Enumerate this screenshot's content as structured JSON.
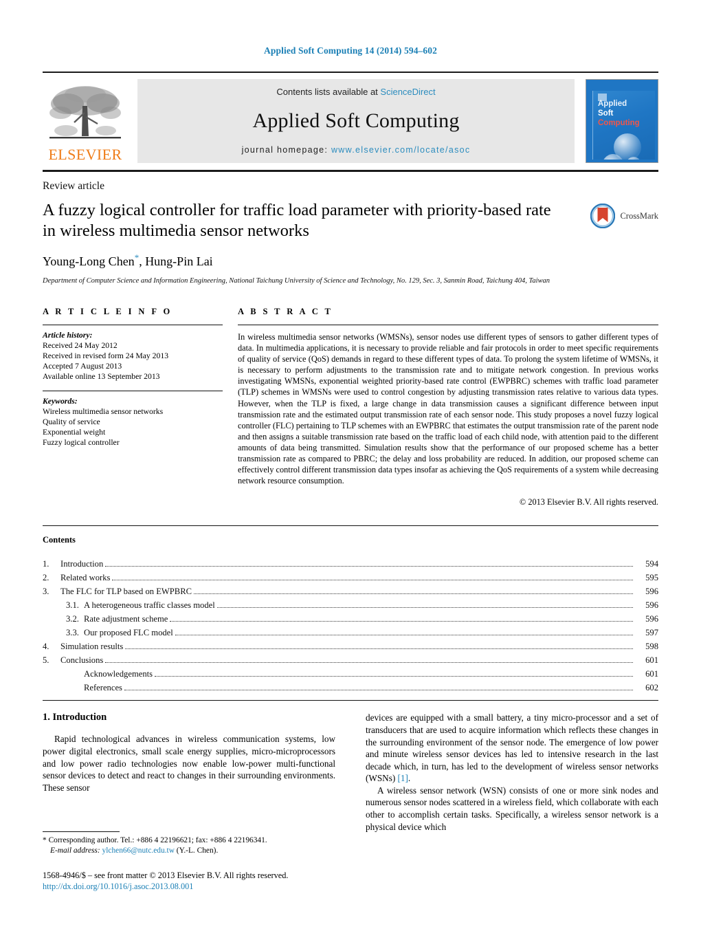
{
  "running_head": "Applied Soft Computing 14 (2014) 594–602",
  "masthead": {
    "contents_lists_prefix": "Contents lists available at ",
    "sciencedirect": "ScienceDirect",
    "journal_title": "Applied Soft Computing",
    "homepage_prefix": "journal homepage: ",
    "homepage_url": "www.elsevier.com/locate/asoc",
    "publisher_wordmark": "ELSEVIER",
    "cover": {
      "line1": "Applied",
      "line2": "Soft",
      "line3": "Computing"
    },
    "colors": {
      "link": "#2b8cbe",
      "band": "#e7e7e7",
      "elsevier_orange": "#ef7c18",
      "cover_blue": "#1f76c4",
      "cover_red": "#f0564a"
    }
  },
  "article": {
    "type": "Review article",
    "title": "A fuzzy logical controller for traffic load parameter with priority-based rate in wireless multimedia sensor networks",
    "authors": "Young-Long Chen",
    "authors_rest": ", Hung-Pin Lai",
    "corresponding_marker": "*",
    "affiliation": "Department of Computer Science and Information Engineering, National Taichung University of Science and Technology, No. 129, Sec. 3, Sanmin Road, Taichung 404, Taiwan",
    "crossmark_label": "CrossMark"
  },
  "article_info": {
    "heading": "A R T I C L E    I N F O",
    "history_label": "Article history:",
    "history": [
      "Received 24 May 2012",
      "Received in revised form 24 May 2013",
      "Accepted 7 August 2013",
      "Available online 13 September 2013"
    ],
    "keywords_label": "Keywords:",
    "keywords": [
      "Wireless multimedia sensor networks",
      "Quality of service",
      "Exponential weight",
      "Fuzzy logical controller"
    ]
  },
  "abstract": {
    "heading": "A B S T R A C T",
    "paragraphs": [
      "In wireless multimedia sensor networks (WMSNs), sensor nodes use different types of sensors to gather different types of data. In multimedia applications, it is necessary to provide reliable and fair protocols in order to meet specific requirements of quality of service (QoS) demands in regard to these different types of data. To prolong the system lifetime of WMSNs, it is necessary to perform adjustments to the transmission rate and to mitigate network congestion. In previous works investigating WMSNs, exponential weighted priority-based rate control (EWPBRC) schemes with traffic load parameter (TLP) schemes in WMSNs were used to control congestion by adjusting transmission rates relative to various data types. However, when the TLP is fixed, a large change in data transmission causes a significant difference between input transmission rate and the estimated output transmission rate of each sensor node. This study proposes a novel fuzzy logical controller (FLC) pertaining to TLP schemes with an EWPBRC that estimates the output transmission rate of the parent node and then assigns a suitable transmission rate based on the traffic load of each child node, with attention paid to the different amounts of data being transmitted. Simulation results show that the performance of our proposed scheme has a better transmission rate as compared to PBRC; the delay and loss probability are reduced. In addition, our proposed scheme can effectively control different transmission data types insofar as achieving the QoS requirements of a system while decreasing network resource consumption."
    ],
    "copyright": "© 2013 Elsevier B.V. All rights reserved."
  },
  "contents": {
    "heading": "Contents",
    "entries": [
      {
        "num": "1.",
        "label": "Introduction",
        "page": "594",
        "level": 1
      },
      {
        "num": "2.",
        "label": "Related works",
        "page": "595",
        "level": 1
      },
      {
        "num": "3.",
        "label": "The FLC for TLP based on EWPBRC",
        "page": "596",
        "level": 1
      },
      {
        "num": "3.1.",
        "label": "A heterogeneous traffic classes model",
        "page": "596",
        "level": 2
      },
      {
        "num": "3.2.",
        "label": "Rate adjustment scheme",
        "page": "596",
        "level": 2
      },
      {
        "num": "3.3.",
        "label": "Our proposed FLC model",
        "page": "597",
        "level": 2
      },
      {
        "num": "4.",
        "label": "Simulation results",
        "page": "598",
        "level": 1
      },
      {
        "num": "5.",
        "label": "Conclusions",
        "page": "601",
        "level": 1
      },
      {
        "num": "",
        "label": "Acknowledgements",
        "page": "601",
        "level": 2
      },
      {
        "num": "",
        "label": "References",
        "page": "602",
        "level": 2
      }
    ]
  },
  "body": {
    "section_heading": "1.  Introduction",
    "left_paragraph": "Rapid technological advances in wireless communication systems, low power digital electronics, small scale energy supplies, micro-microprocessors and low power radio technologies now enable low-power multi-functional sensor devices to detect and react to changes in their surrounding environments. These sensor",
    "right_paragraph_1": "devices are equipped with a small battery, a tiny micro-processor and a set of transducers that are used to acquire information which reflects these changes in the surrounding environment of the sensor node. The emergence of low power and minute wireless sensor devices has led to intensive research in the last decade which, in turn, has led to the development of wireless sensor networks (WSNs)",
    "right_paragraph_1_ref": "[1]",
    "right_paragraph_1_end": ".",
    "right_paragraph_2": "A wireless sensor network (WSN) consists of one or more sink nodes and numerous sensor nodes scattered in a wireless field, which collaborate with each other to accomplish certain tasks. Specifically, a wireless sensor network is a physical device which"
  },
  "footnote": {
    "marker": "*",
    "corresponding": "Corresponding author. Tel.: +886 4 22196621; fax: +886 4 22196341.",
    "email_label": "E-mail address:",
    "email": "ylchen66@nutc.edu.tw",
    "email_owner": "(Y.-L. Chen).",
    "issn_line": "1568-4946/$ – see front matter © 2013 Elsevier B.V. All rights reserved.",
    "doi": "http://dx.doi.org/10.1016/j.asoc.2013.08.001"
  }
}
